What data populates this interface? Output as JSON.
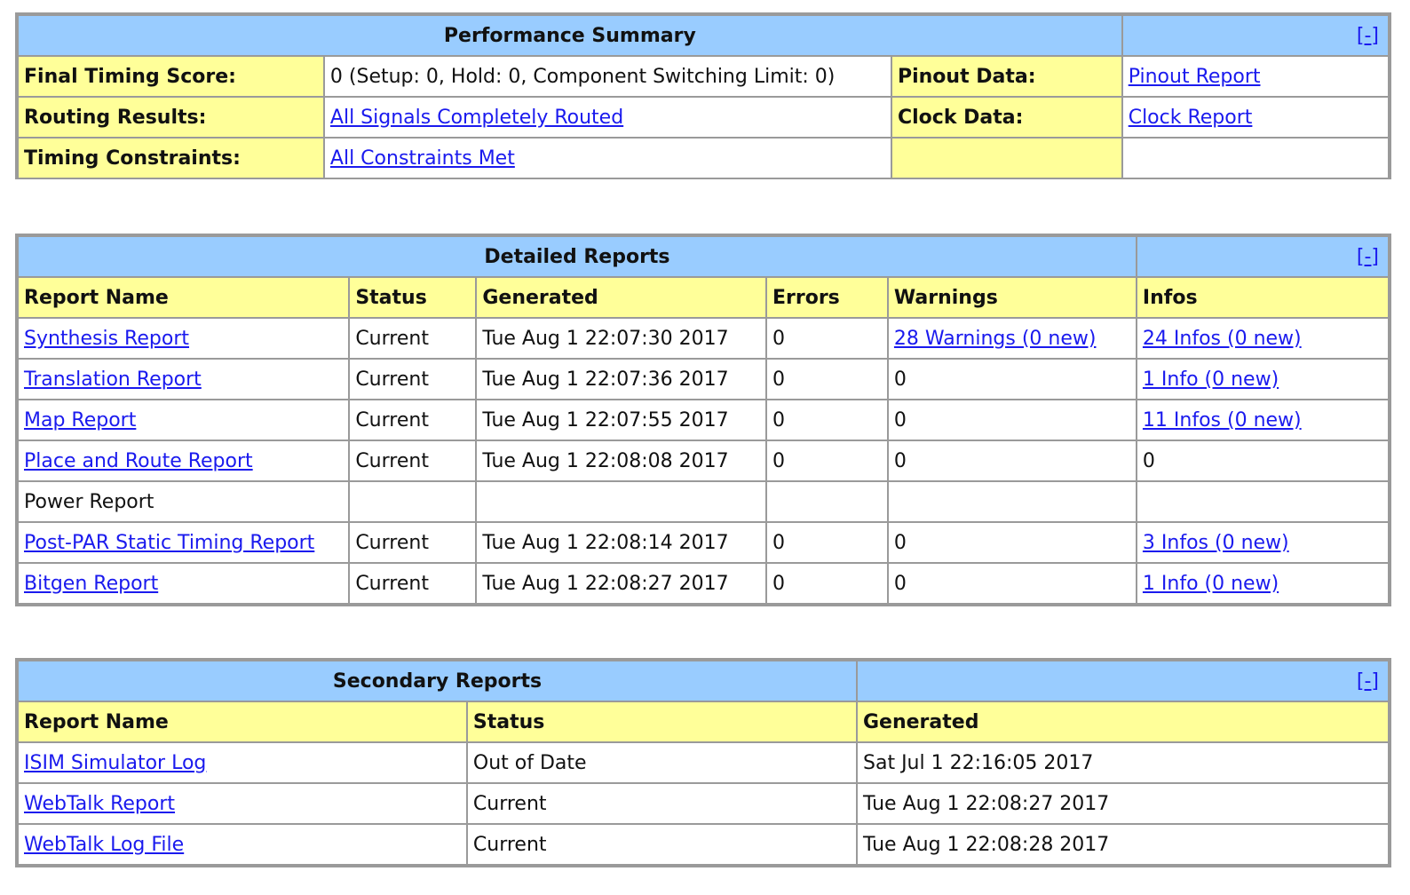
{
  "toggle_label": "[-]",
  "performance_summary": {
    "title": "Performance Summary",
    "rows": [
      {
        "label": "Final Timing Score:",
        "value": "0 (Setup: 0, Hold: 0, Component Switching Limit: 0)",
        "value_link": false,
        "label2": "Pinout Data:",
        "value2": "Pinout Report",
        "value2_link": true
      },
      {
        "label": "Routing Results:",
        "value": "All Signals Completely Routed",
        "value_link": true,
        "label2": "Clock Data:",
        "value2": "Clock Report",
        "value2_link": true
      },
      {
        "label": "Timing Constraints:",
        "value": "All Constraints Met",
        "value_link": true,
        "label2": "",
        "value2": "",
        "value2_link": false
      }
    ]
  },
  "detailed_reports": {
    "title": "Detailed Reports",
    "headers": [
      "Report Name",
      "Status",
      "Generated",
      "Errors",
      "Warnings",
      "Infos"
    ],
    "rows": [
      {
        "name": "Synthesis Report",
        "name_link": true,
        "status": "Current",
        "generated": "Tue Aug 1 22:07:30 2017",
        "errors": "0",
        "warnings": "28 Warnings (0 new)",
        "warnings_link": true,
        "infos": "24 Infos (0 new)",
        "infos_link": true
      },
      {
        "name": "Translation Report",
        "name_link": true,
        "status": "Current",
        "generated": "Tue Aug 1 22:07:36 2017",
        "errors": "0",
        "warnings": "0",
        "warnings_link": false,
        "infos": "1 Info (0 new)",
        "infos_link": true
      },
      {
        "name": "Map Report",
        "name_link": true,
        "status": "Current",
        "generated": "Tue Aug 1 22:07:55 2017",
        "errors": "0",
        "warnings": "0",
        "warnings_link": false,
        "infos": "11 Infos (0 new)",
        "infos_link": true
      },
      {
        "name": "Place and Route Report",
        "name_link": true,
        "status": "Current",
        "generated": "Tue Aug 1 22:08:08 2017",
        "errors": "0",
        "warnings": "0",
        "warnings_link": false,
        "infos": "0",
        "infos_link": false
      },
      {
        "name": "Power Report",
        "name_link": false,
        "status": "",
        "generated": "",
        "errors": "",
        "warnings": "",
        "warnings_link": false,
        "infos": "",
        "infos_link": false
      },
      {
        "name": "Post-PAR Static Timing Report",
        "name_link": true,
        "status": "Current",
        "generated": "Tue Aug 1 22:08:14 2017",
        "errors": "0",
        "warnings": "0",
        "warnings_link": false,
        "infos": "3 Infos (0 new)",
        "infos_link": true
      },
      {
        "name": "Bitgen Report",
        "name_link": true,
        "status": "Current",
        "generated": "Tue Aug 1 22:08:27 2017",
        "errors": "0",
        "warnings": "0",
        "warnings_link": false,
        "infos": "1 Info (0 new)",
        "infos_link": true
      }
    ]
  },
  "secondary_reports": {
    "title": "Secondary Reports",
    "headers": [
      "Report Name",
      "Status",
      "Generated"
    ],
    "rows": [
      {
        "name": "ISIM Simulator Log",
        "status": "Out of Date",
        "generated": "Sat Jul 1 22:16:05 2017"
      },
      {
        "name": "WebTalk Report",
        "status": "Current",
        "generated": "Tue Aug 1 22:08:27 2017"
      },
      {
        "name": "WebTalk Log File",
        "status": "Current",
        "generated": "Tue Aug 1 22:08:28 2017"
      }
    ]
  },
  "colors": {
    "title_bg": "#99ccff",
    "label_bg": "#ffff99",
    "link": "#1a1aee",
    "border": "#9a9a9a"
  }
}
